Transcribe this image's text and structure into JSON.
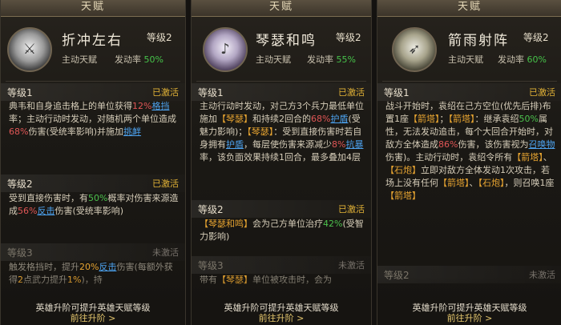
{
  "panels": [
    {
      "title": "天赋",
      "name": "折冲左右",
      "level": "等级2",
      "type": "主动天赋",
      "rate_label": "发动率",
      "rate_value": "50%",
      "sections": [
        {
          "level": "等级1",
          "status": "已激活",
          "text": [
            {
              "t": "典韦和自身追击格上的单位获得"
            },
            {
              "t": "12%",
              "c": "r"
            },
            {
              "t": "格挡",
              "c": "b"
            },
            {
              "t": "率；"
            },
            {
              "t": "主动行动时发动，对随机两个单位造成"
            },
            {
              "t": "68%",
              "c": "r"
            },
            {
              "t": "伤害(受统率影响)并施加"
            },
            {
              "t": "挑衅",
              "c": "b"
            }
          ]
        },
        {
          "level": "等级2",
          "status": "已激活",
          "text": [
            {
              "t": "受到直接伤害时，有"
            },
            {
              "t": "50%",
              "c": "g"
            },
            {
              "t": "概率对伤害来源造成"
            },
            {
              "t": "56%",
              "c": "r"
            },
            {
              "t": "反击",
              "c": "b"
            },
            {
              "t": "伤害(受统率影响)"
            }
          ]
        },
        {
          "level": "等级3",
          "status": "未激活",
          "text": [
            {
              "t": "触发格挡时，提升"
            },
            {
              "t": "20%",
              "c": "o"
            },
            {
              "t": "反击",
              "c": "b"
            },
            {
              "t": "伤害("
            },
            {
              "t": "每额外获得"
            },
            {
              "t": "2",
              "c": "o"
            },
            {
              "t": "点武力提升"
            },
            {
              "t": "1%",
              "c": "o"
            },
            {
              "t": ")，持"
            }
          ]
        }
      ],
      "footer": "英雄升阶可提升英雄天赋等级",
      "go": "前往升阶 >"
    },
    {
      "title": "天赋",
      "name": "琴瑟和鸣",
      "level": "等级2",
      "type": "主动天赋",
      "rate_label": "发动率",
      "rate_value": "55%",
      "sections": [
        {
          "level": "等级1",
          "status": "已激活",
          "text": [
            {
              "t": "主动行动时发动，对己方3个兵力最低单位施加"
            },
            {
              "t": "【琴瑟】",
              "c": "o"
            },
            {
              "t": "和持续2回合的"
            },
            {
              "t": "68%",
              "c": "r"
            },
            {
              "t": "护盾",
              "c": "b"
            },
            {
              "t": "(受魅力影响)；"
            },
            {
              "t": "【琴瑟】",
              "c": "o"
            },
            {
              "t": "：受到直接伤害时若自身拥有"
            },
            {
              "t": "护盾",
              "c": "b"
            },
            {
              "t": "，每层使伤害来源减少"
            },
            {
              "t": "8%",
              "c": "r"
            },
            {
              "t": "抗暴",
              "c": "b"
            },
            {
              "t": "率，该负面效果持续1回合，最多叠加4层"
            }
          ]
        },
        {
          "level": "等级2",
          "status": "已激活",
          "text": [
            {
              "t": "【琴瑟和鸣】",
              "c": "o"
            },
            {
              "t": "会为己方单位治疗"
            },
            {
              "t": "42%",
              "c": "g"
            },
            {
              "t": "(受智力影响)"
            }
          ]
        },
        {
          "level": "等级3",
          "status": "未激活",
          "text": [
            {
              "t": "带有"
            },
            {
              "t": "【琴瑟】",
              "c": "o"
            },
            {
              "t": "单位被攻击时，会为"
            }
          ]
        }
      ],
      "footer": "英雄升阶可提升英雄天赋等级",
      "go": "前往升阶 >"
    },
    {
      "title": "天赋",
      "name": "箭雨射阵",
      "level": "等级2",
      "type": "主动天赋",
      "rate_label": "发动率",
      "rate_value": "60%",
      "sections": [
        {
          "level": "等级1",
          "status": "已激活",
          "text": [
            {
              "t": "战斗开始时，袁绍在己方空位(优先后排)布置1座"
            },
            {
              "t": "【箭塔】",
              "c": "o"
            },
            {
              "t": "；"
            },
            {
              "t": "【箭塔】",
              "c": "o"
            },
            {
              "t": "：继承袁绍"
            },
            {
              "t": "50%",
              "c": "g"
            },
            {
              "t": "属性，无法发动追击，每个大回合开始时，对敌方全体造成"
            },
            {
              "t": "86%",
              "c": "r"
            },
            {
              "t": "伤害，该伤害视为"
            },
            {
              "t": "召唤物",
              "c": "b"
            },
            {
              "t": "伤害)。"
            },
            {
              "t": "主动行动时，袁绍令所有"
            },
            {
              "t": "【箭塔】",
              "c": "o"
            },
            {
              "t": "、"
            },
            {
              "t": "【石炮】",
              "c": "o"
            },
            {
              "t": "立即对敌方全体发动1次攻击，若场上没有任何"
            },
            {
              "t": "【箭塔】",
              "c": "o"
            },
            {
              "t": "、"
            },
            {
              "t": "【石炮】",
              "c": "o"
            },
            {
              "t": "，则召唤1座"
            },
            {
              "t": "【箭塔】",
              "c": "o"
            }
          ]
        },
        {
          "level": "等级2",
          "status": "未激活",
          "text": []
        }
      ],
      "footer": "英雄升阶可提升英雄天赋等级",
      "go": "前往升阶 >"
    }
  ]
}
